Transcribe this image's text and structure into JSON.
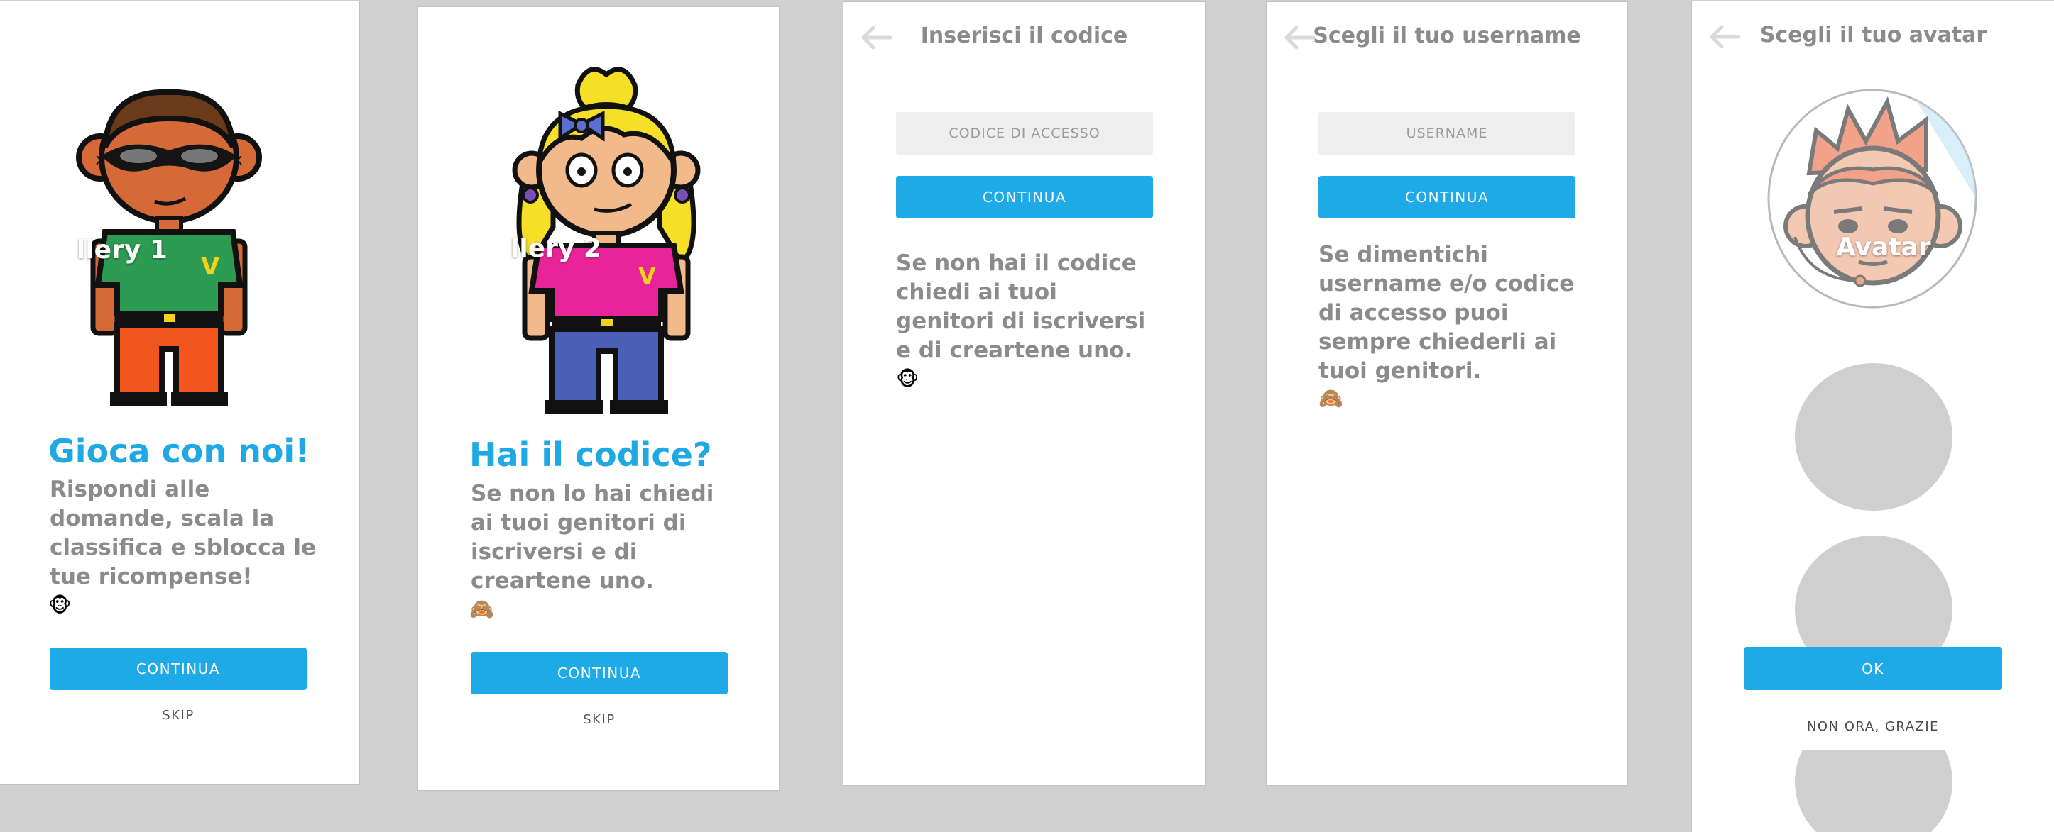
{
  "screens": {
    "onboarding_1": {
      "gallery_label": "llery 1",
      "heading": "Gioca con noi!",
      "body": "Rispondi alle domande, scala la classifica e sblocca le tue ricompense!",
      "emoji": "🐵",
      "continue_label": "CONTINUA",
      "skip_label": "SKIP"
    },
    "onboarding_2": {
      "gallery_label": "llery 2",
      "heading": "Hai il codice?",
      "body": "Se non lo hai chiedi ai tuoi genitori di iscriversi e di creartene uno.",
      "emoji": "🙈",
      "continue_label": "CONTINUA",
      "skip_label": "SKIP"
    },
    "code_entry": {
      "title": "Inserisci il codice",
      "code_placeholder": "CODICE DI ACCESSO",
      "continue_label": "CONTINUA",
      "help_text": "Se non hai il codice chiedi ai tuoi genitori di iscriversi e di creartene uno.",
      "emoji": "🐵"
    },
    "username": {
      "title": "Scegli il tuo username",
      "username_placeholder": "USERNAME",
      "continue_label": "CONTINUA",
      "help_text": "Se dimentichi username e/o codice di accesso puoi sempre chiederli ai tuoi genitori.",
      "emoji": "🙈"
    },
    "avatar": {
      "title": "Scegli il tuo avatar",
      "avatar_label": "Avatar",
      "ok_label": "OK",
      "later_label": "NON ORA, GRAZIE"
    }
  },
  "colors": {
    "accent": "#1eaae6",
    "text_gray": "#8b8b8b",
    "field_bg": "#eeeeee",
    "canvas_bg": "#d0d0d0",
    "placeholder_circle": "#cfcfcf"
  },
  "icons": [
    "back-arrow-icon",
    "monkey-face-emoji",
    "see-no-evil-monkey-emoji"
  ]
}
